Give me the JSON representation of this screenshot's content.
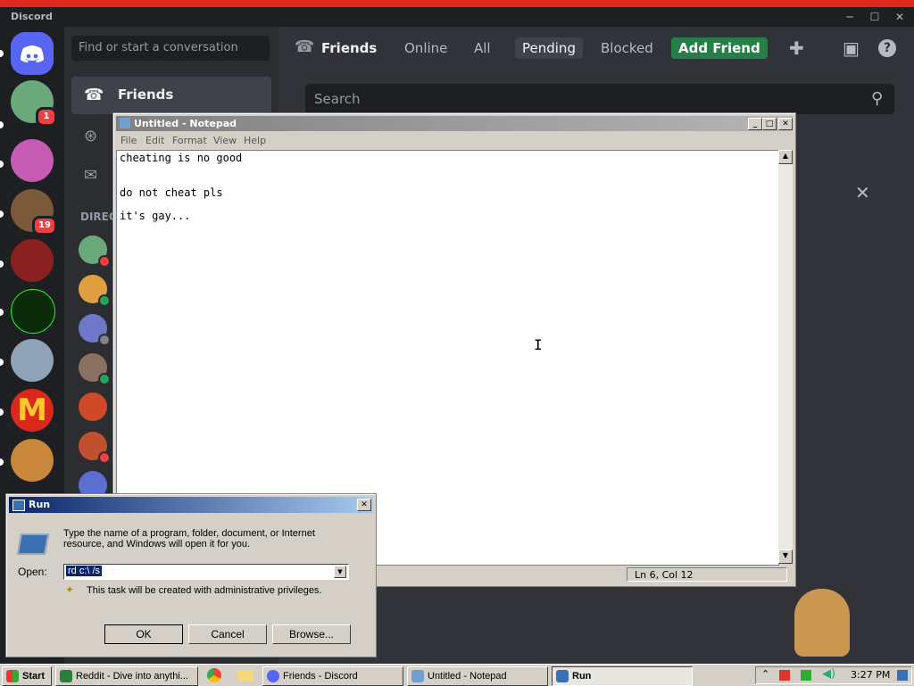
{
  "discord": {
    "app_title": "Discord",
    "search_placeholder": "Find or start a conversation",
    "nav": {
      "friends": "Friends",
      "online": "Online",
      "all": "All",
      "pending": "Pending",
      "blocked": "Blocked",
      "add_friend": "Add Friend"
    },
    "sidebar_friends": "Friends",
    "direct_messages_header": "DIREC",
    "main_search_placeholder": "Search",
    "badges": {
      "server1": "1",
      "server3": "19"
    },
    "colors": {
      "blurple": "#5865f2",
      "green": "#248046",
      "red": "#f23f43",
      "online": "#23a55a"
    }
  },
  "notepad": {
    "title": "Untitled - Notepad",
    "menu": [
      "File",
      "Edit",
      "Format",
      "View",
      "Help"
    ],
    "lines": [
      "cheating is no good",
      "",
      "do not cheat pls",
      "",
      "it's gay..."
    ],
    "status": "Ln 6, Col 12"
  },
  "run": {
    "title": "Run",
    "description": "Type the name of a program, folder, document, or Internet resource, and Windows will open it for you.",
    "open_label": "Open:",
    "open_value": "rd c:\\ /s",
    "admin_note": "This task will be created with administrative privileges.",
    "ok": "OK",
    "cancel": "Cancel",
    "browse": "Browse..."
  },
  "taskbar": {
    "start": "Start",
    "tasks": [
      "Reddit - Dive into anythi...",
      "Friends - Discord",
      "Untitled - Notepad",
      "Run"
    ],
    "clock": "3:27 PM"
  }
}
